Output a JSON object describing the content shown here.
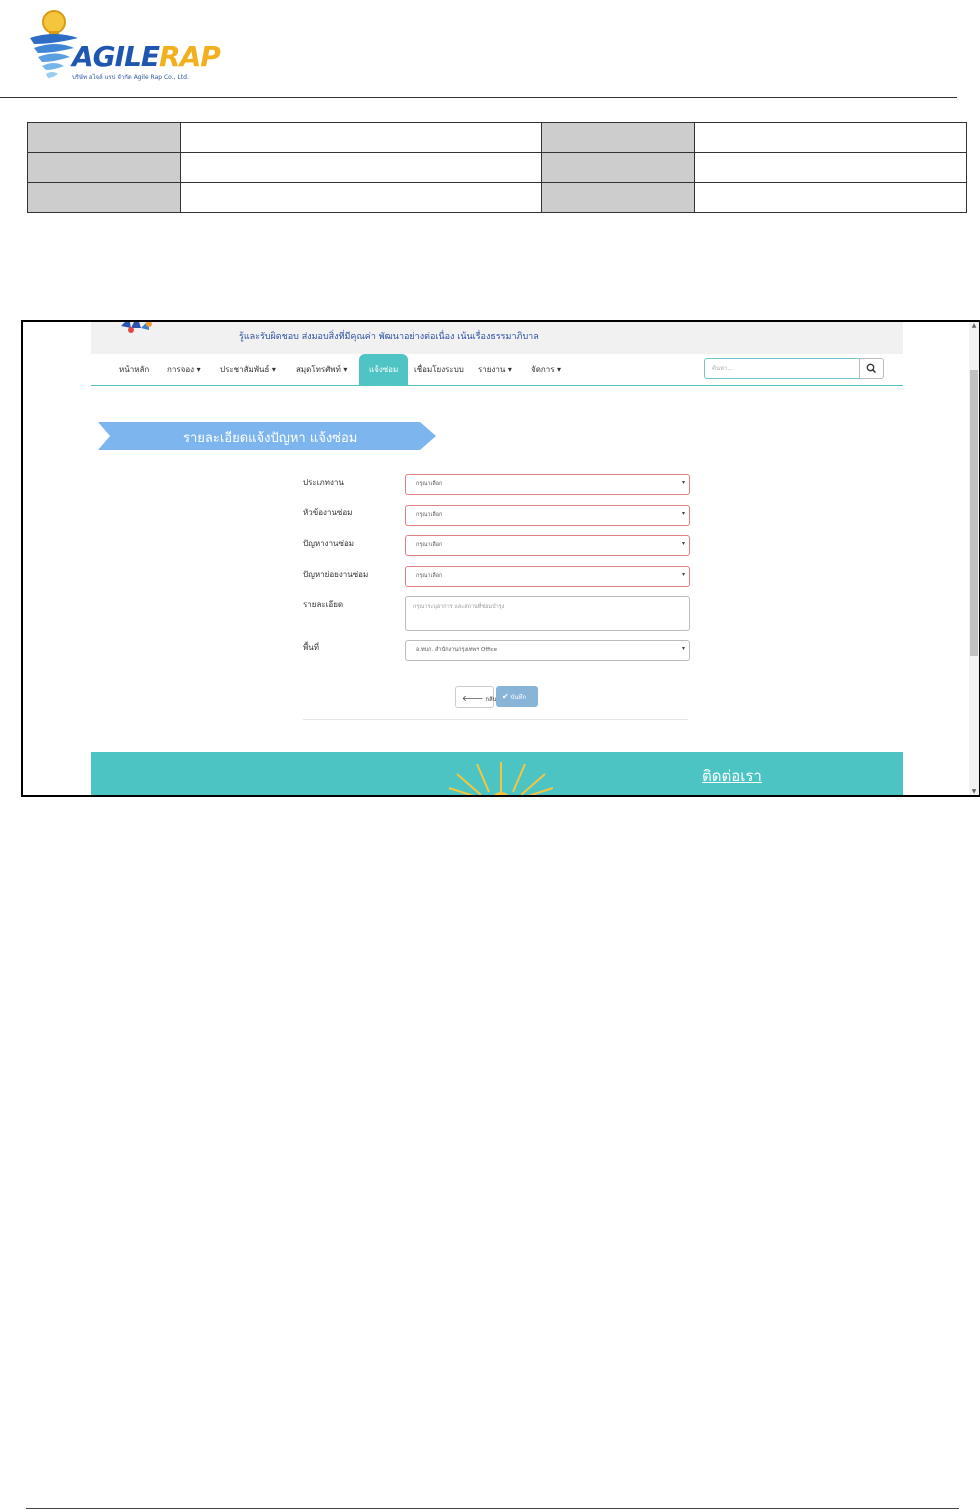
{
  "document": {
    "logo": {
      "wordmark_part1": "AGILE",
      "wordmark_part2": "RAP",
      "subtitle": "บริษัท อไจล์ แรป จำกัด Agile Rap Co., Ltd.",
      "colors": {
        "primary": "#1f56b0",
        "accent": "#f2b01e"
      }
    },
    "info_table": {
      "rows": [
        [
          "",
          "",
          "",
          ""
        ],
        [
          "",
          "",
          "",
          ""
        ],
        [
          "",
          "",
          "",
          ""
        ]
      ]
    }
  },
  "screenshot": {
    "header": {
      "tagline": "รู้และรับผิดชอบ ส่งมอบสิ่งที่มีคุณค่า พัฒนาอย่างต่อเนื่อง เน้นเรื่องธรรมาภิบาล"
    },
    "nav": {
      "items": [
        {
          "label": "หน้าหลัก"
        },
        {
          "label": "การจอง ▾"
        },
        {
          "label": "ประชาสัมพันธ์ ▾"
        },
        {
          "label": "สมุดโทรศัพท์ ▾"
        },
        {
          "label": "แจ้งซ่อม",
          "active": true
        },
        {
          "label": "เชื่อมโยงระบบ"
        },
        {
          "label": "รายงาน ▾"
        },
        {
          "label": "จัดการ ▾"
        }
      ],
      "search_placeholder": "ค้นหา..."
    },
    "banner": {
      "title": "รายละเอียดแจ้งปัญหา แจ้งซ่อม"
    },
    "form": {
      "fields": [
        {
          "label": "ประเภทงาน",
          "value": "กรุณาเลือก"
        },
        {
          "label": "หัวข้องานซ่อม",
          "value": "กรุณาเลือก"
        },
        {
          "label": "ปัญหางานซ่อม",
          "value": "กรุณาเลือก"
        },
        {
          "label": "ปัญหาย่อยงานซ่อม",
          "value": "กรุณาเลือก"
        }
      ],
      "detail": {
        "label": "รายละเอียด",
        "placeholder": "กรุณาระบุอาการ และสถานที่ซ่อมบำรุง"
      },
      "area": {
        "label": "พื้นที่",
        "value": "อ.ทบก. สำนักงานกรุงเทพฯ Office"
      },
      "back_label": "กลับ",
      "save_label": "บันทึก"
    },
    "footer": {
      "title": "ติดต่อเรา",
      "colors": {
        "bg": "#4cc4c4"
      }
    }
  }
}
